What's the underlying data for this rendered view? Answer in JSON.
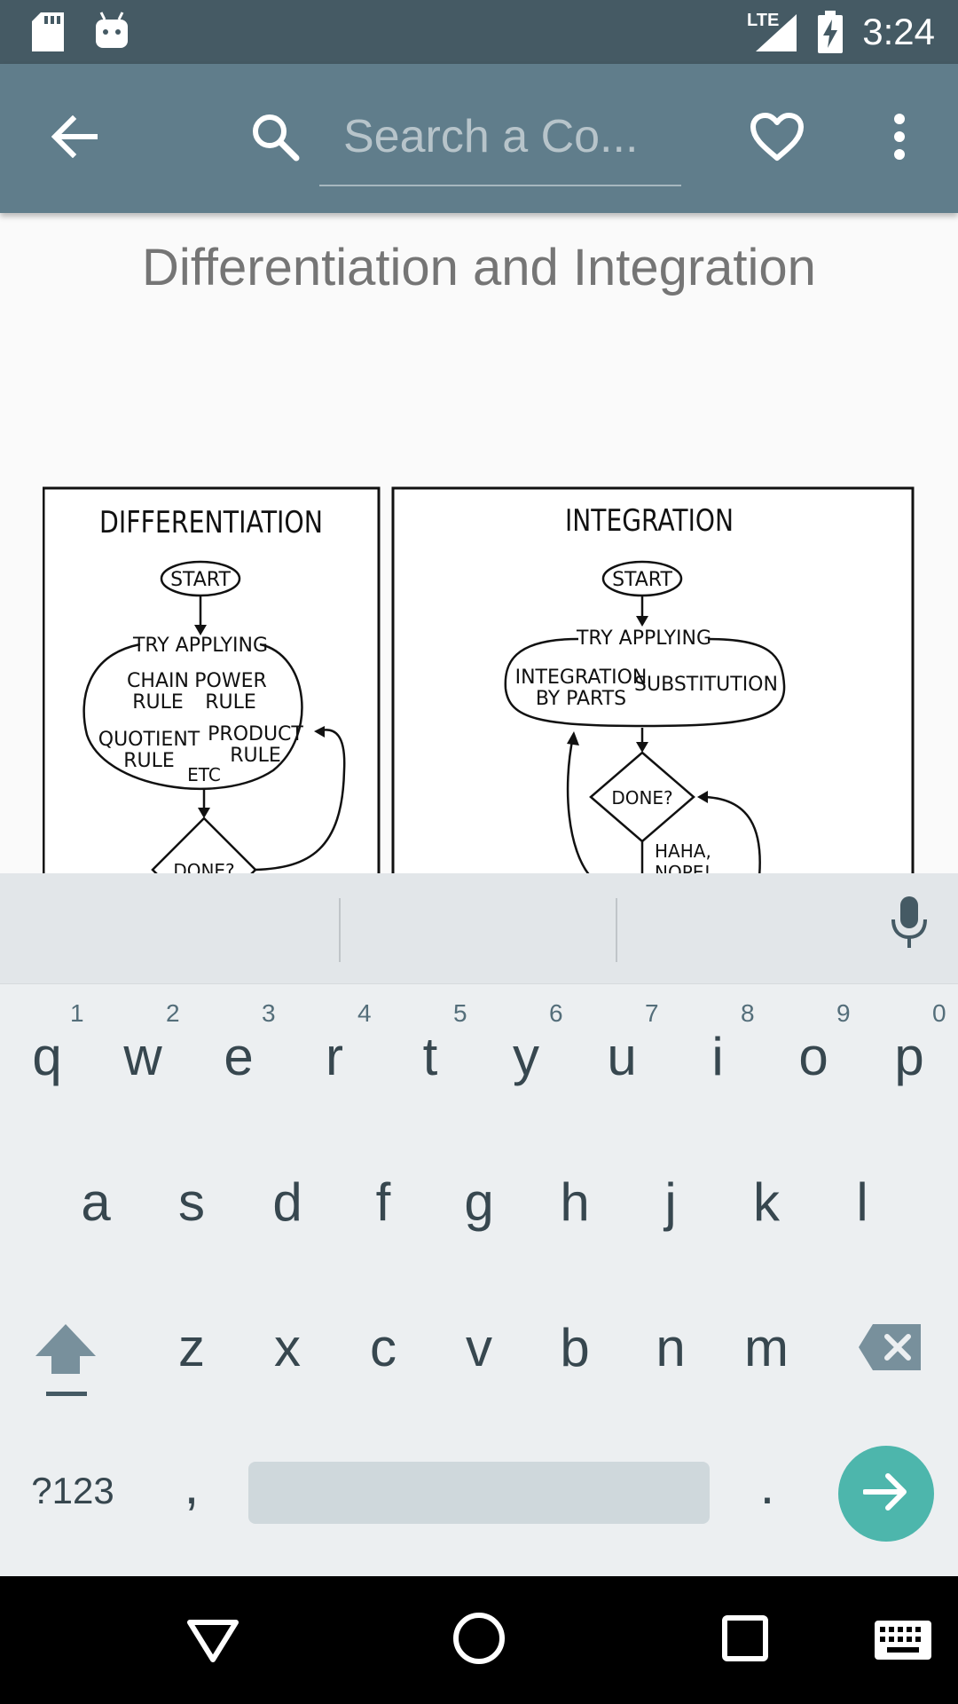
{
  "status_bar": {
    "time": "3:24",
    "network": "LTE",
    "icons": [
      "sd-card-icon",
      "android-debug-icon",
      "lte-signal-icon",
      "battery-charging-icon"
    ]
  },
  "toolbar": {
    "search_placeholder": "Search a Co...",
    "icons": [
      "back-arrow-icon",
      "search-icon",
      "heart-icon",
      "more-vert-icon"
    ]
  },
  "content": {
    "title": "Differentiation and Integration",
    "comic": {
      "differentiation": {
        "heading": "DIFFERENTIATION",
        "start": "START",
        "try": "TRY APPLYING",
        "chain1": "CHAIN",
        "chain2": "RULE",
        "power1": "POWER",
        "power2": "RULE",
        "quot1": "QUOTIENT",
        "quot2": "RULE",
        "prod1": "PRODUCT",
        "prod2": "RULE",
        "etc": "ETC",
        "done": "DONE?"
      },
      "integration": {
        "heading": "INTEGRATION",
        "start": "START",
        "try": "TRY APPLYING",
        "ibp1": "INTEGRATION",
        "ibp2": "BY PARTS",
        "subst": "SUBSTITUTION",
        "done": "DONE?",
        "haha1": "HAHA,",
        "haha2": "NOPE!"
      }
    }
  },
  "keyboard": {
    "row1": [
      {
        "k": "q",
        "n": "1"
      },
      {
        "k": "w",
        "n": "2"
      },
      {
        "k": "e",
        "n": "3"
      },
      {
        "k": "r",
        "n": "4"
      },
      {
        "k": "t",
        "n": "5"
      },
      {
        "k": "y",
        "n": "6"
      },
      {
        "k": "u",
        "n": "7"
      },
      {
        "k": "i",
        "n": "8"
      },
      {
        "k": "o",
        "n": "9"
      },
      {
        "k": "p",
        "n": "0"
      }
    ],
    "row2": [
      "a",
      "s",
      "d",
      "f",
      "g",
      "h",
      "j",
      "k",
      "l"
    ],
    "row3": [
      "z",
      "x",
      "c",
      "v",
      "b",
      "n",
      "m"
    ],
    "symbols_label": "?123",
    "comma": ",",
    "period": ".",
    "icons": [
      "mic-icon",
      "shift-icon",
      "backspace-icon",
      "enter-arrow-icon"
    ]
  },
  "nav_bar": {
    "icons": [
      "back-triangle-icon",
      "home-circle-icon",
      "recents-square-icon",
      "keyboard-icon"
    ]
  },
  "colors": {
    "status_bar": "#455a64",
    "toolbar": "#607d8b",
    "keyboard_bg": "#eceff1",
    "enter_key": "#4db6ac"
  }
}
